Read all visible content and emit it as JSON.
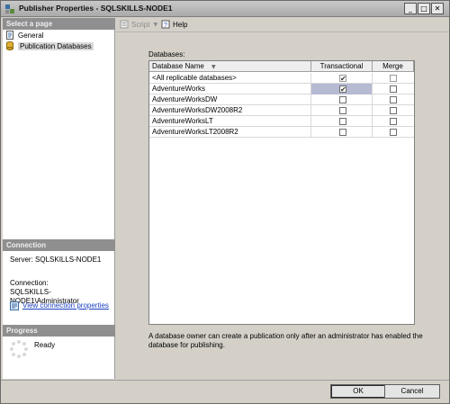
{
  "window": {
    "title": "Publisher Properties - SQLSKILLS-NODE1"
  },
  "left_pane": {
    "select_page_header": "Select a page",
    "nav_items": [
      {
        "label": "General",
        "icon": "page-icon"
      },
      {
        "label": "Publication Databases",
        "icon": "database-icon"
      }
    ],
    "connection_header": "Connection",
    "server": "Server: SQLSKILLS-NODE1",
    "connection_label": "Connection:",
    "connection_value": "SQLSKILLS-NODE1\\Administrator",
    "view_link": "View connection properties",
    "progress_header": "Progress",
    "progress_status": "Ready"
  },
  "toolbar": {
    "script_label": "Script",
    "help_label": "Help"
  },
  "main": {
    "databases_label": "Databases:",
    "columns": {
      "name": "Database Name",
      "transactional": "Transactional",
      "merge": "Merge"
    },
    "rows": [
      {
        "name": "<All replicable databases>",
        "transactional": true,
        "merge": false
      },
      {
        "name": "AdventureWorks",
        "transactional": true,
        "merge": false
      },
      {
        "name": "AdventureWorksDW",
        "transactional": false,
        "merge": false
      },
      {
        "name": "AdventureWorksDW2008R2",
        "transactional": false,
        "merge": false
      },
      {
        "name": "AdventureWorksLT",
        "transactional": false,
        "merge": false
      },
      {
        "name": "AdventureWorksLT2008R2",
        "transactional": false,
        "merge": false
      }
    ],
    "note": "A database owner can create a publication only after an administrator has enabled the database for publishing."
  },
  "buttons": {
    "ok": "OK",
    "cancel": "Cancel"
  }
}
